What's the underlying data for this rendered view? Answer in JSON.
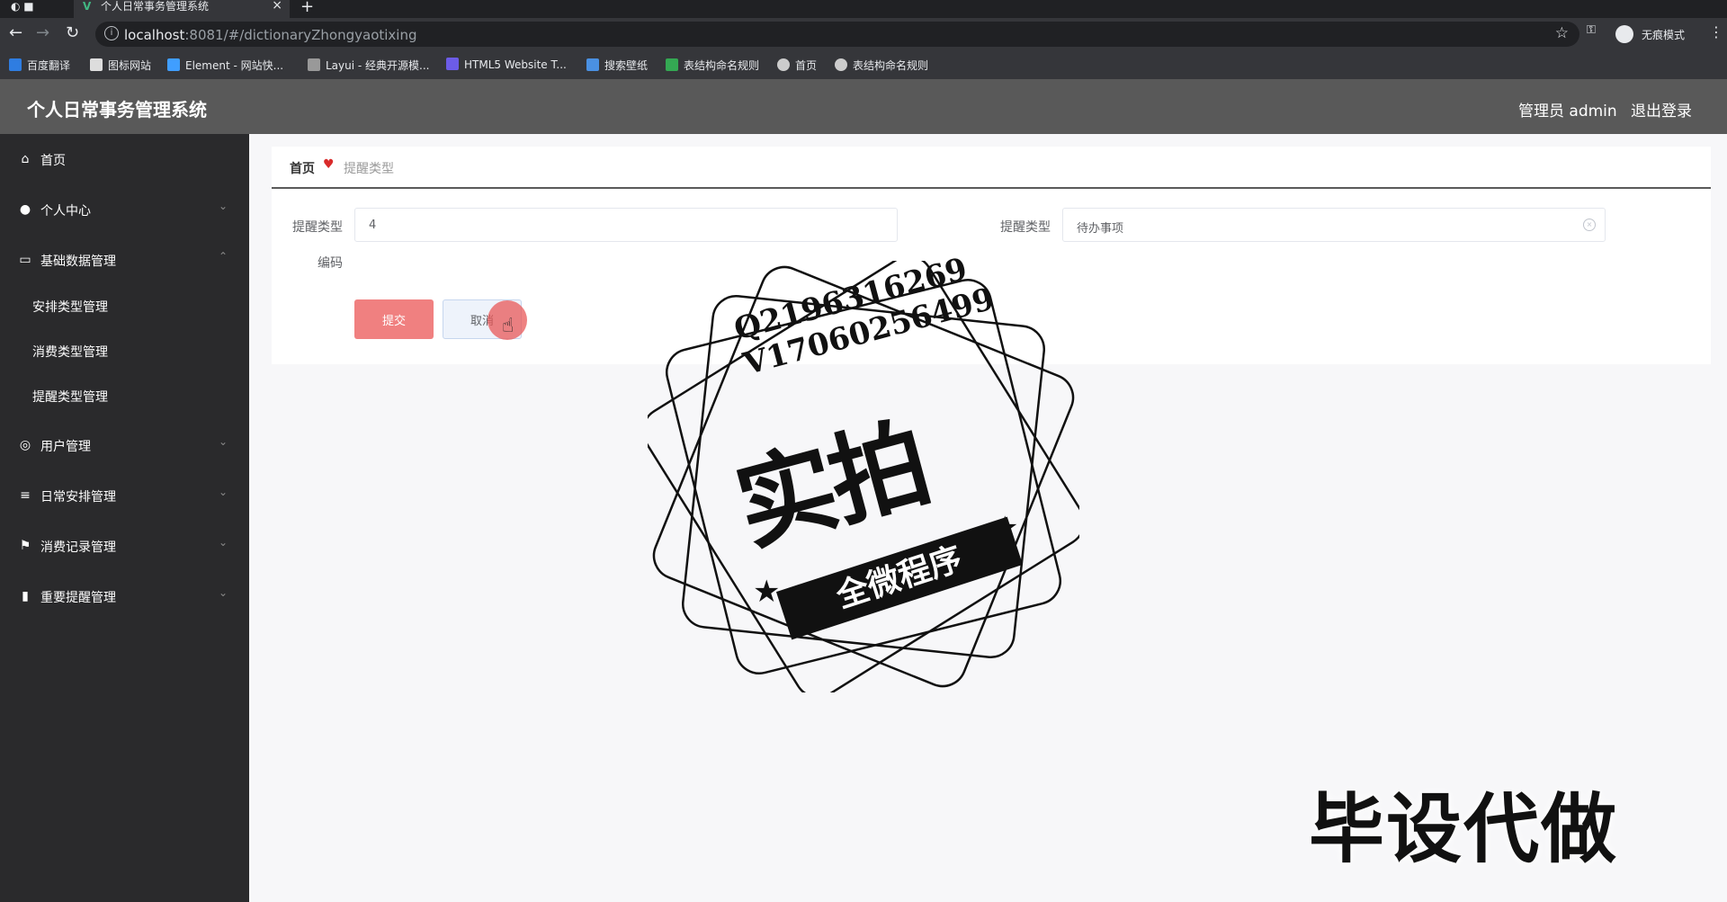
{
  "browser": {
    "tab_title": "个人日常事务管理系统",
    "url_host": "localhost",
    "url_rest": ":8081/#/dictionaryZhongyaotixing",
    "incognito_label": "无痕模式",
    "bookmarks": [
      "百度翻译",
      "图标网站",
      "Element - 网站快...",
      "Layui - 经典开源模...",
      "HTML5 Website T...",
      "搜索壁纸",
      "表结构命名规则",
      "首页",
      "表结构命名规则"
    ]
  },
  "header": {
    "title": "个人日常事务管理系统",
    "admin": "管理员 admin",
    "logout": "退出登录"
  },
  "sidebar": {
    "items": [
      {
        "label": "首页",
        "icon": "home-icon"
      },
      {
        "label": "个人中心",
        "icon": "user-icon"
      },
      {
        "label": "基础数据管理",
        "icon": "card-icon"
      },
      {
        "label": "用户管理",
        "icon": "globe-icon"
      },
      {
        "label": "日常安排管理",
        "icon": "list-icon"
      },
      {
        "label": "消费记录管理",
        "icon": "flag-icon"
      },
      {
        "label": "重要提醒管理",
        "icon": "bar-chart-icon"
      }
    ],
    "subitems": [
      "安排类型管理",
      "消费类型管理",
      "提醒类型管理"
    ]
  },
  "breadcrumb": {
    "home": "首页",
    "current": "提醒类型"
  },
  "form": {
    "code_label_1": "提醒类型",
    "code_label_2": "编码",
    "code_value": "4",
    "type_label": "提醒类型",
    "type_value": "待办事项",
    "submit": "提交",
    "cancel": "取消"
  },
  "watermark": {
    "qq": "Q2196316269",
    "vx": "V17060256499",
    "big": "实拍",
    "banner": "全微程序",
    "bottom": "毕设代做"
  }
}
